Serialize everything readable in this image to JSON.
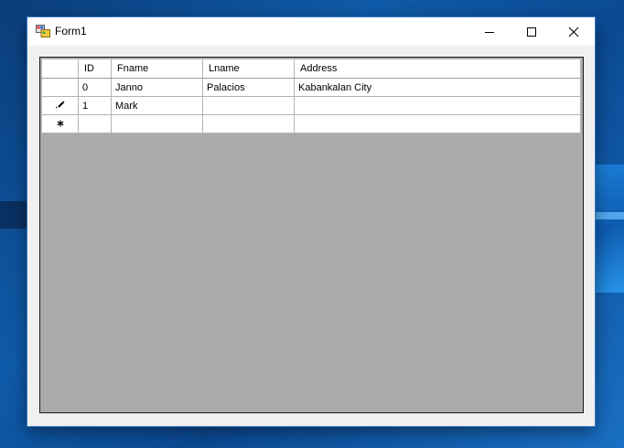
{
  "window": {
    "title": "Form1"
  },
  "grid": {
    "columns": [
      "ID",
      "Fname",
      "Lname",
      "Address"
    ],
    "rows": [
      {
        "marker": "",
        "id": "0",
        "fname": "Janno",
        "lname": "Palacios",
        "address": "Kabankalan City"
      },
      {
        "marker": "pencil",
        "id": "1",
        "fname": "Mark",
        "lname": "",
        "address": ""
      },
      {
        "marker": "new-row",
        "id": "",
        "fname": "",
        "lname": "",
        "address": ""
      }
    ]
  },
  "colors": {
    "grid_background": "#ababab",
    "title_bar": "#ffffff",
    "desktop_accent": "#0f5aa8"
  }
}
